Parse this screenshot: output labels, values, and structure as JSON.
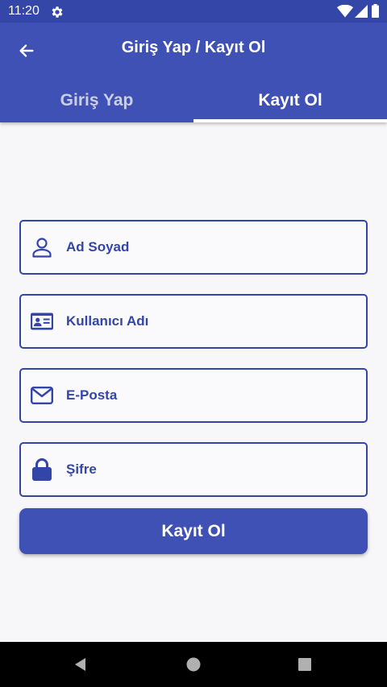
{
  "status_bar": {
    "time": "11:20"
  },
  "app_bar": {
    "title": "Giriş Yap / Kayıt Ol"
  },
  "tabs": [
    {
      "label": "Giriş Yap",
      "active": false
    },
    {
      "label": "Kayıt Ol",
      "active": true
    }
  ],
  "form": {
    "full_name": {
      "placeholder": "Ad Soyad",
      "icon": "person-icon"
    },
    "username": {
      "placeholder": "Kullanıcı Adı",
      "icon": "id-card-icon"
    },
    "email": {
      "placeholder": "E-Posta",
      "icon": "envelope-icon"
    },
    "password": {
      "placeholder": "Şifre",
      "icon": "lock-icon"
    }
  },
  "submit": {
    "label": "Kayıt Ol"
  },
  "colors": {
    "primary": "#3f51b5",
    "status_bar": "#3447a8",
    "field_accent": "#3445a8",
    "background": "#f7f7f9"
  }
}
